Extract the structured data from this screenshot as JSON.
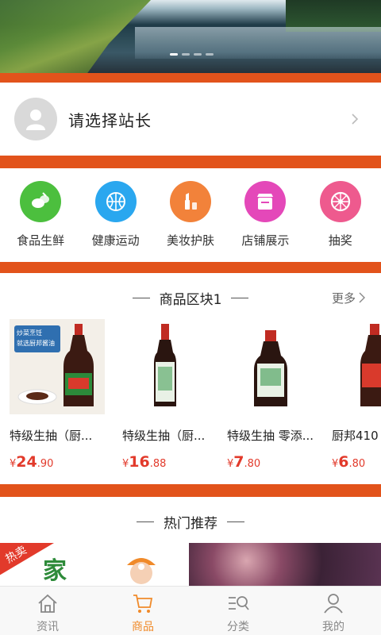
{
  "banner": {
    "dots": 4
  },
  "station": {
    "label": "请选择站长"
  },
  "categories": [
    {
      "label": "食品生鲜",
      "icon": "fruit-icon",
      "color": "#4cbf3e"
    },
    {
      "label": "健康运动",
      "icon": "basketball-icon",
      "color": "#2aa7ef"
    },
    {
      "label": "美妆护肤",
      "icon": "lipstick-icon",
      "color": "#f2823a"
    },
    {
      "label": "店铺展示",
      "icon": "store-icon",
      "color": "#e448b9"
    },
    {
      "label": "抽奖",
      "icon": "wheel-icon",
      "color": "#ee5a8e"
    }
  ],
  "section1": {
    "title": "商品区块1",
    "more": "更多"
  },
  "products": [
    {
      "name": "特级生抽（厨...",
      "price_int": "24",
      "price_dec": ".90",
      "currency": "¥",
      "ad_lines": [
        "炒菜烹饪",
        "就选厨邦酱油"
      ]
    },
    {
      "name": "特级生抽（厨...",
      "price_int": "16",
      "price_dec": ".88",
      "currency": "¥"
    },
    {
      "name": "特级生抽 零添...",
      "price_int": "7",
      "price_dec": ".80",
      "currency": "¥"
    },
    {
      "name": "厨邦410",
      "price_int": "6",
      "price_dec": ".80",
      "currency": "¥"
    }
  ],
  "section2": {
    "title": "热门推荐"
  },
  "hot": {
    "ribbon": "热卖",
    "brand_text": "家"
  },
  "tabs": [
    {
      "label": "资讯",
      "icon": "home-icon",
      "active": false
    },
    {
      "label": "商品",
      "icon": "cart-icon",
      "active": true
    },
    {
      "label": "分类",
      "icon": "category-search-icon",
      "active": false
    },
    {
      "label": "我的",
      "icon": "user-icon",
      "active": false
    }
  ],
  "colors": {
    "accent": "#e2531b",
    "price": "#e23a2b",
    "tab_active": "#f08a2a"
  }
}
